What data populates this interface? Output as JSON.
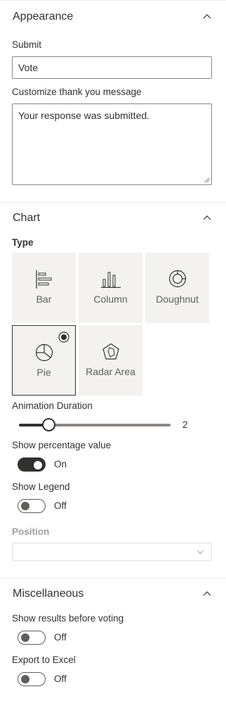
{
  "appearance": {
    "title": "Appearance",
    "submit_label": "Submit",
    "submit_value": "Vote",
    "thank_you_label": "Customize thank you message",
    "thank_you_value": "Your response was submitted."
  },
  "chart": {
    "title": "Chart",
    "type_label": "Type",
    "types": [
      {
        "label": "Bar",
        "icon": "bar-chart-icon"
      },
      {
        "label": "Column",
        "icon": "column-chart-icon"
      },
      {
        "label": "Doughnut",
        "icon": "doughnut-chart-icon"
      },
      {
        "label": "Pie",
        "icon": "pie-chart-icon",
        "selected": true
      },
      {
        "label": "Radar Area",
        "icon": "radar-area-chart-icon"
      }
    ],
    "animation_label": "Animation Duration",
    "animation_value": "2",
    "show_percentage_label": "Show percentage value",
    "show_percentage_state": "On",
    "show_legend_label": "Show Legend",
    "show_legend_state": "Off",
    "position_label": "Position",
    "position_value": ""
  },
  "misc": {
    "title": "Miscellaneous",
    "show_results_label": "Show results before voting",
    "show_results_state": "Off",
    "export_label": "Export to Excel",
    "export_state": "Off"
  },
  "colors": {
    "text": "#323130",
    "secondary_text": "#605e5c",
    "tile_background": "#f3f2f1",
    "divider": "#edebe9"
  }
}
